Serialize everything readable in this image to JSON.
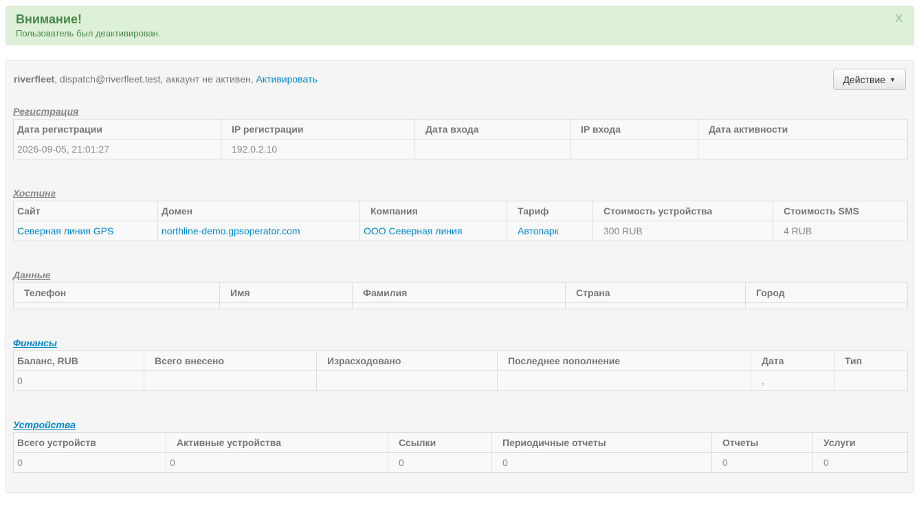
{
  "alert": {
    "title": "Внимание!",
    "text": "Пользователь был деактивирован.",
    "close": "X"
  },
  "user": {
    "login": "riverfleet",
    "rest": ", dispatch@riverfleet.test, аккаунт не активен, ",
    "activate_link": "Активировать"
  },
  "action_button": {
    "label": "Действие",
    "caret": "▼"
  },
  "registration": {
    "title": "Регистрация",
    "headers": [
      "Дата регистрации",
      "IP регистрации",
      "Дата входа",
      "IP входа",
      "Дата активности"
    ],
    "row": [
      "2026-09-05, 21:01:27",
      "192.0.2.10",
      "",
      "",
      ""
    ]
  },
  "hosting": {
    "title": "Хостинг",
    "headers": [
      "Сайт",
      "Домен",
      "Компания",
      "Тариф",
      "Стоимость устройства",
      "Стоимость SMS"
    ],
    "row": [
      "Северная линия GPS",
      "northline-demo.gpsoperator.com",
      "ООО Северная линия",
      "Автопарк",
      "300 RUB",
      "4 RUB"
    ]
  },
  "personal": {
    "title": "Данные",
    "headers": [
      "Телефон",
      "Имя",
      "Фамилия",
      "Страна",
      "Город"
    ],
    "row": [
      "",
      "",
      "",
      "",
      ""
    ]
  },
  "finance": {
    "title": "Финансы",
    "headers": [
      "Баланс, RUB",
      "Всего внесено",
      "Израсходовано",
      "Последнее пополнение",
      "Дата",
      "Тип"
    ],
    "row": [
      "0",
      "",
      "",
      "",
      ",",
      ""
    ]
  },
  "devices": {
    "title": "Устройства",
    "headers": [
      "Всего устройств",
      "Активные устройства",
      "Ссылки",
      "Периодичные отчеты",
      "Отчеты",
      "Услуги"
    ],
    "row": [
      "0",
      "0",
      "0",
      "0",
      "0",
      "0"
    ]
  }
}
